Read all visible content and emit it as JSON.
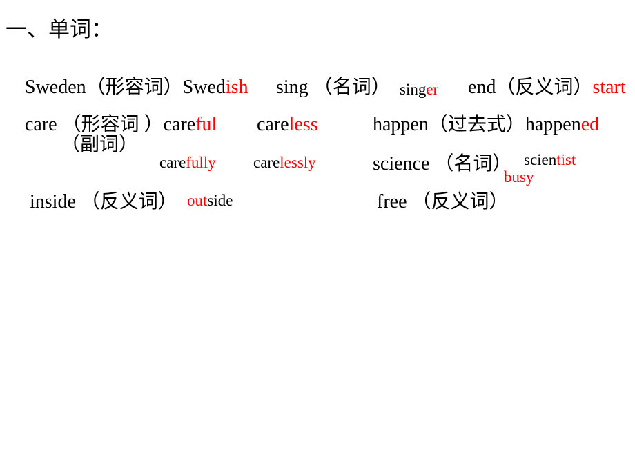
{
  "slide": {
    "background_color": "#ffffff",
    "text_color": "#000000",
    "accent_color": "#ff0000",
    "title": "一、单词："
  },
  "entries": [
    {
      "id": "sweden",
      "row": 1,
      "base": "Sweden",
      "hint": "（形容词）",
      "answer_stem": "Swed",
      "answer_suffix": "ish",
      "answer_full": "Swedish"
    },
    {
      "id": "sing",
      "row": 1,
      "base": "sing",
      "hint": "（名词）",
      "answer_stem": "sing",
      "answer_suffix": "er",
      "answer_full": "singer"
    },
    {
      "id": "end",
      "row": 1,
      "base": "end",
      "hint": "（反义词）",
      "answer_stem": "",
      "answer_suffix": "start",
      "answer_full": "start"
    },
    {
      "id": "care-adj",
      "row": 2,
      "base": "care",
      "hint": "（形容词 ）",
      "answer_stem": "care",
      "answer_suffix": "ful",
      "answer_full": "careful",
      "answer2_stem": "care",
      "answer2_suffix": "less",
      "answer2_full": "careless"
    },
    {
      "id": "happen",
      "row": 2,
      "base": "happen",
      "hint": "（过去式）",
      "answer_stem": "happen",
      "answer_suffix": "ed",
      "answer_full": "happened"
    },
    {
      "id": "care-adv",
      "row": 3,
      "base": "",
      "hint": "（副词）",
      "answer_stem": "care",
      "answer_suffix": "fully",
      "answer_full": "carefully",
      "answer2_stem": "care",
      "answer2_suffix": "lessly",
      "answer2_full": "carelessly"
    },
    {
      "id": "science",
      "row": 3,
      "base": "science",
      "hint": "（名词）",
      "answer_stem": "scien",
      "answer_suffix": "tist",
      "answer_full": "scientist"
    },
    {
      "id": "inside",
      "row": 4,
      "base": "inside",
      "hint": "（反义词）",
      "answer_stem": "out",
      "answer_suffix": "side",
      "answer_full": "outside"
    },
    {
      "id": "free",
      "row": 4,
      "base": "free",
      "hint": "（反义词）",
      "answer_stem": "",
      "answer_suffix": "busy",
      "answer_full": "busy"
    }
  ],
  "text": {
    "title": "一、单词：",
    "sweden_base": "Sweden",
    "sweden_hint": "（形容词）",
    "sweden_stem": "Swed",
    "sweden_suffix": "ish",
    "sing_base": "sing",
    "sing_hint": "（名词）",
    "sing_stem": "sing",
    "sing_suffix": "er",
    "end_base": "end",
    "end_hint": "（反义词）",
    "end_answer": "start",
    "care_base": "care",
    "care_hint_adj": "（形容词 ）",
    "careful_stem": "care",
    "careful_suffix": "ful",
    "careless_stem": "care",
    "careless_suffix": "less",
    "happen_base": "happen",
    "happen_hint": "（过去式）",
    "happen_stem": "happen",
    "happen_suffix": "ed",
    "care_hint_adv": "（副词）",
    "carefully_stem": "care",
    "carefully_suffix": "fully",
    "carelessly_stem": "care",
    "carelessly_suffix": "lessly",
    "science_base": "science",
    "science_hint": "（名词）",
    "scientist_stem": "scien",
    "scientist_suffix": "tist",
    "inside_base": "inside",
    "inside_hint": "（反义词）",
    "outside_stem": "out",
    "outside_suffix": "side",
    "free_base": "free",
    "free_hint": "（反义词）",
    "busy_answer": "busy"
  }
}
